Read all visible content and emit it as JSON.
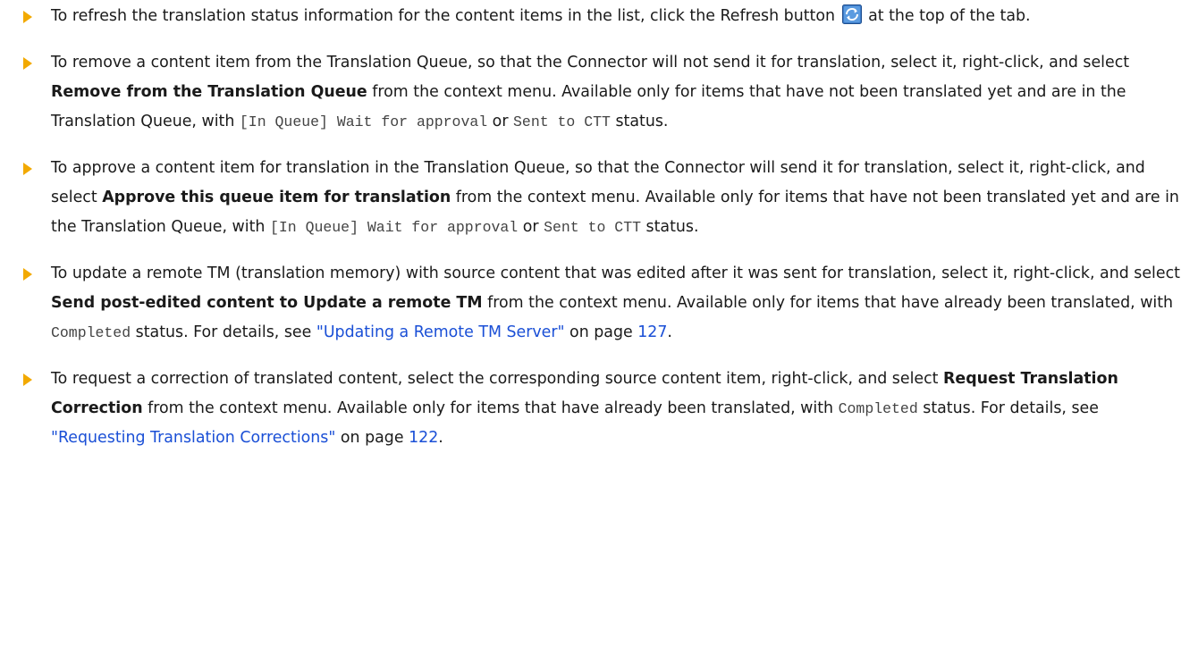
{
  "items": [
    {
      "t1": "To refresh the translation status information for the content items in the list, click the Refresh button",
      "icon": "refresh-icon",
      "t2": " at the top of the tab."
    },
    {
      "t1": "To remove a content item from the Translation Queue, so that the Connector will not send it for translation, select it, right-click, and select ",
      "bold": "Remove from the Translation Queue",
      "t2": " from the context menu. Available only for items that have not been translated yet and are in the Translation Queue, with ",
      "code1": "[In Queue] Wait for approval",
      "t3": " or ",
      "code2": "Sent to CTT",
      "t4": " status."
    },
    {
      "t1": "To approve a content item for translation in the Translation Queue, so that the Connector will send it for translation, select it, right-click, and select ",
      "bold": "Approve this queue item for translation",
      "t2": " from the context menu. Available only for items that have not been translated yet and are in the Translation Queue, with ",
      "code1": "[In Queue] Wait for approval",
      "t3": " or ",
      "code2": "Sent to CTT",
      "t4": " status."
    },
    {
      "t1": "To update a remote TM (translation memory) with source content that was edited after it was sent for translation, select it, right-click, and select ",
      "bold": "Send post-edited content to Update a remote TM",
      "t2": " from the context menu. Available only for items that have already been translated, with ",
      "code1": "Completed",
      "t3": " status. For details, see ",
      "link": "\"Updating a Remote TM Server\"",
      "t4": " on page ",
      "page": "127",
      "t5": "."
    },
    {
      "t1": "To request a correction of translated content, select the corresponding source content item, right-click, and select ",
      "bold": "Request Translation Correction",
      "t2": " from the context menu. Available only for items that have already been translated, with ",
      "code1": "Completed",
      "t3": " status. For details, see ",
      "link": "\"Requesting Translation Corrections\"",
      "t4": " on page ",
      "page": "122",
      "t5": "."
    }
  ]
}
